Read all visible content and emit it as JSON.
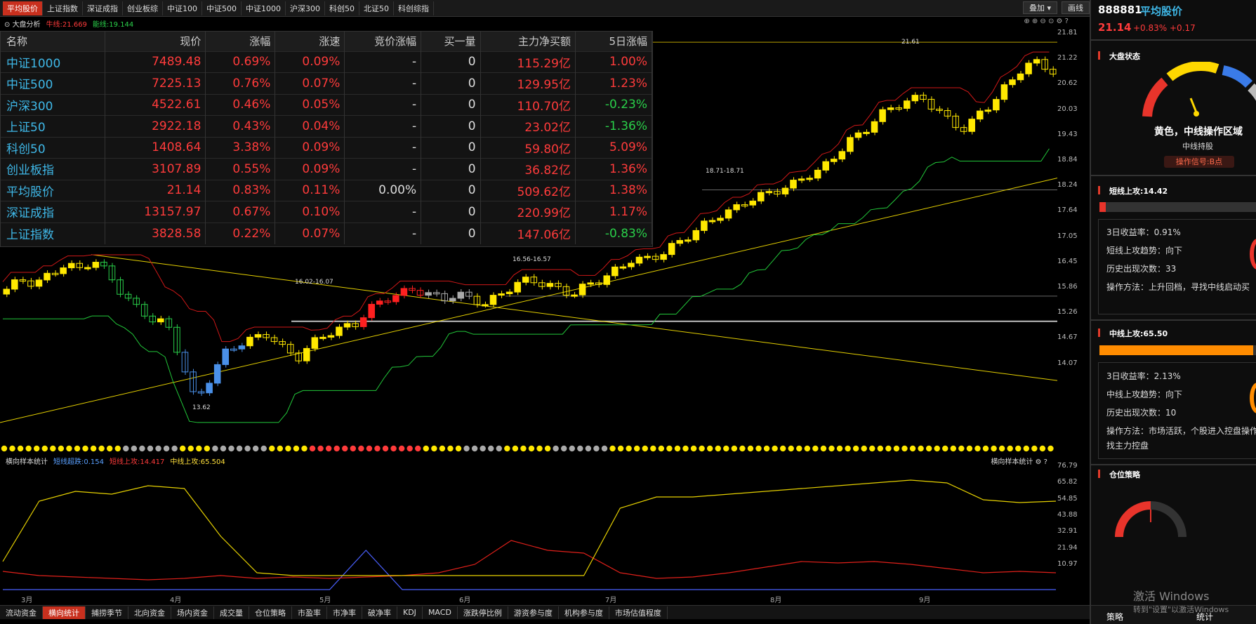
{
  "top_tabs": [
    "平均股价",
    "上证指数",
    "深证成指",
    "创业板综",
    "中证100",
    "中证500",
    "中证1000",
    "沪深300",
    "科创50",
    "北证50",
    "科创综指"
  ],
  "top_right": {
    "overlay_label": "叠加",
    "draw_label": "画线"
  },
  "legend": {
    "title": "大盘分析",
    "bull": "牛线:21.669",
    "energy": "能线:19.144"
  },
  "table": {
    "headers": [
      "名称",
      "现价",
      "涨幅",
      "涨速",
      "竞价涨幅",
      "买一量",
      "主力净买额",
      "5日涨幅"
    ],
    "rows": [
      {
        "name": "中证1000",
        "price": "7489.48",
        "chg": "0.69%",
        "speed": "0.09%",
        "bid": "-",
        "buy1": "0",
        "net": "115.29亿",
        "d5": "1.00%",
        "d5c": "red"
      },
      {
        "name": "中证500",
        "price": "7225.13",
        "chg": "0.76%",
        "speed": "0.07%",
        "bid": "-",
        "buy1": "0",
        "net": "129.95亿",
        "d5": "1.23%",
        "d5c": "red"
      },
      {
        "name": "沪深300",
        "price": "4522.61",
        "chg": "0.46%",
        "speed": "0.05%",
        "bid": "-",
        "buy1": "0",
        "net": "110.70亿",
        "d5": "-0.23%",
        "d5c": "green"
      },
      {
        "name": "上证50",
        "price": "2922.18",
        "chg": "0.43%",
        "speed": "0.04%",
        "bid": "-",
        "buy1": "0",
        "net": "23.02亿",
        "d5": "-1.36%",
        "d5c": "green"
      },
      {
        "name": "科创50",
        "price": "1408.64",
        "chg": "3.38%",
        "speed": "0.09%",
        "bid": "-",
        "buy1": "0",
        "net": "59.80亿",
        "d5": "5.09%",
        "d5c": "red"
      },
      {
        "name": "创业板指",
        "price": "3107.89",
        "chg": "0.55%",
        "speed": "0.09%",
        "bid": "-",
        "buy1": "0",
        "net": "36.82亿",
        "d5": "1.36%",
        "d5c": "red"
      },
      {
        "name": "平均股价",
        "price": "21.14",
        "chg": "0.83%",
        "speed": "0.11%",
        "bid": "0.00%",
        "buy1": "0",
        "net": "509.62亿",
        "d5": "1.38%",
        "d5c": "red"
      },
      {
        "name": "深证成指",
        "price": "13157.97",
        "chg": "0.67%",
        "speed": "0.10%",
        "bid": "-",
        "buy1": "0",
        "net": "220.99亿",
        "d5": "1.17%",
        "d5c": "red"
      },
      {
        "name": "上证指数",
        "price": "3828.58",
        "chg": "0.22%",
        "speed": "0.07%",
        "bid": "-",
        "buy1": "0",
        "net": "147.06亿",
        "d5": "-0.83%",
        "d5c": "green"
      }
    ]
  },
  "main_yticks": [
    "21.81",
    "21.22",
    "20.62",
    "20.03",
    "19.43",
    "18.84",
    "18.24",
    "17.64",
    "17.05",
    "16.45",
    "15.86",
    "15.26",
    "14.67",
    "14.07"
  ],
  "annotations": {
    "high": "21.61",
    "low": "13.62",
    "r1": "16.02-16.07",
    "r2": "16.56-16.57",
    "r3": "18.71-18.71"
  },
  "lower": {
    "title": "横向样本统计",
    "s1": "短线超跌:0.154",
    "s2": "短线上攻:14.417",
    "s3": "中线上攻:65.504",
    "right_title": "横向样本统计"
  },
  "lower_yticks": [
    "76.79",
    "65.82",
    "54.85",
    "43.88",
    "32.91",
    "21.94",
    "10.97"
  ],
  "months": [
    "3月",
    "4月",
    "5月",
    "6月",
    "7月",
    "8月",
    "9月"
  ],
  "bottom_tabs": [
    "流动资金",
    "横向统计",
    "捕捞季节",
    "北向资金",
    "场内资金",
    "成交量",
    "仓位策略",
    "市盈率",
    "市净率",
    "破净率",
    "KDJ",
    "MACD",
    "涨跌停比例",
    "游资参与度",
    "机构参与度",
    "市场估值程度"
  ],
  "right": {
    "code": "888881",
    "name": "平均股价",
    "price": "21.14",
    "pct": "+0.83%",
    "chg": "+0.17",
    "market_state": "大盘状态",
    "state_text": "黄色，中线操作区域",
    "state_sub": "中线持股",
    "signal": "操作信号:B点",
    "short_title": "短线上攻:14.42",
    "short_ret": "3日收益率：0.91%",
    "short_trend": "短线上攻趋势：向下",
    "short_count": "历史出现次数：33",
    "short_method": "操作方法：上升回档，寻找中线启动买",
    "mid_title": "中线上攻:65.50",
    "mid_ret": "3日收益率：2.13%",
    "mid_trend": "中线上攻趋势：向下",
    "mid_count": "历史出现次数：10",
    "mid_method": "操作方法：市场活跃，个股进入控盘操作，寻",
    "mid_method2": "找主力控盘",
    "pos_title": "仓位策略",
    "bottom_tab": "策略",
    "bottom_tab2": "统计",
    "watermark": "激活 Windows",
    "watermark2": "转到\"设置\"以激活Windows"
  },
  "chart_data": {
    "type": "line",
    "series": [
      {
        "name": "短线超跌",
        "values": [
          2,
          2,
          2,
          2,
          2,
          2,
          2,
          2,
          2,
          2,
          30,
          2,
          2,
          2,
          2,
          2,
          2,
          2,
          2,
          2,
          2,
          2,
          2,
          2,
          2,
          2,
          2,
          2,
          2,
          2
        ]
      },
      {
        "name": "短线上攻",
        "values": [
          15,
          12,
          11,
          10,
          9,
          10,
          12,
          10,
          11,
          10,
          11,
          12,
          14,
          20,
          37,
          30,
          28,
          14,
          10,
          11,
          14,
          18,
          22,
          21,
          22,
          20,
          17,
          14,
          15,
          14
        ]
      },
      {
        "name": "中线上攻",
        "values": [
          22,
          65,
          72,
          70,
          76,
          74,
          40,
          14,
          12,
          12,
          12,
          12,
          12,
          12,
          12,
          12,
          12,
          60,
          68,
          68,
          70,
          72,
          74,
          76,
          78,
          80,
          78,
          66,
          64,
          65
        ]
      }
    ],
    "ylim": [
      0,
      85
    ]
  }
}
